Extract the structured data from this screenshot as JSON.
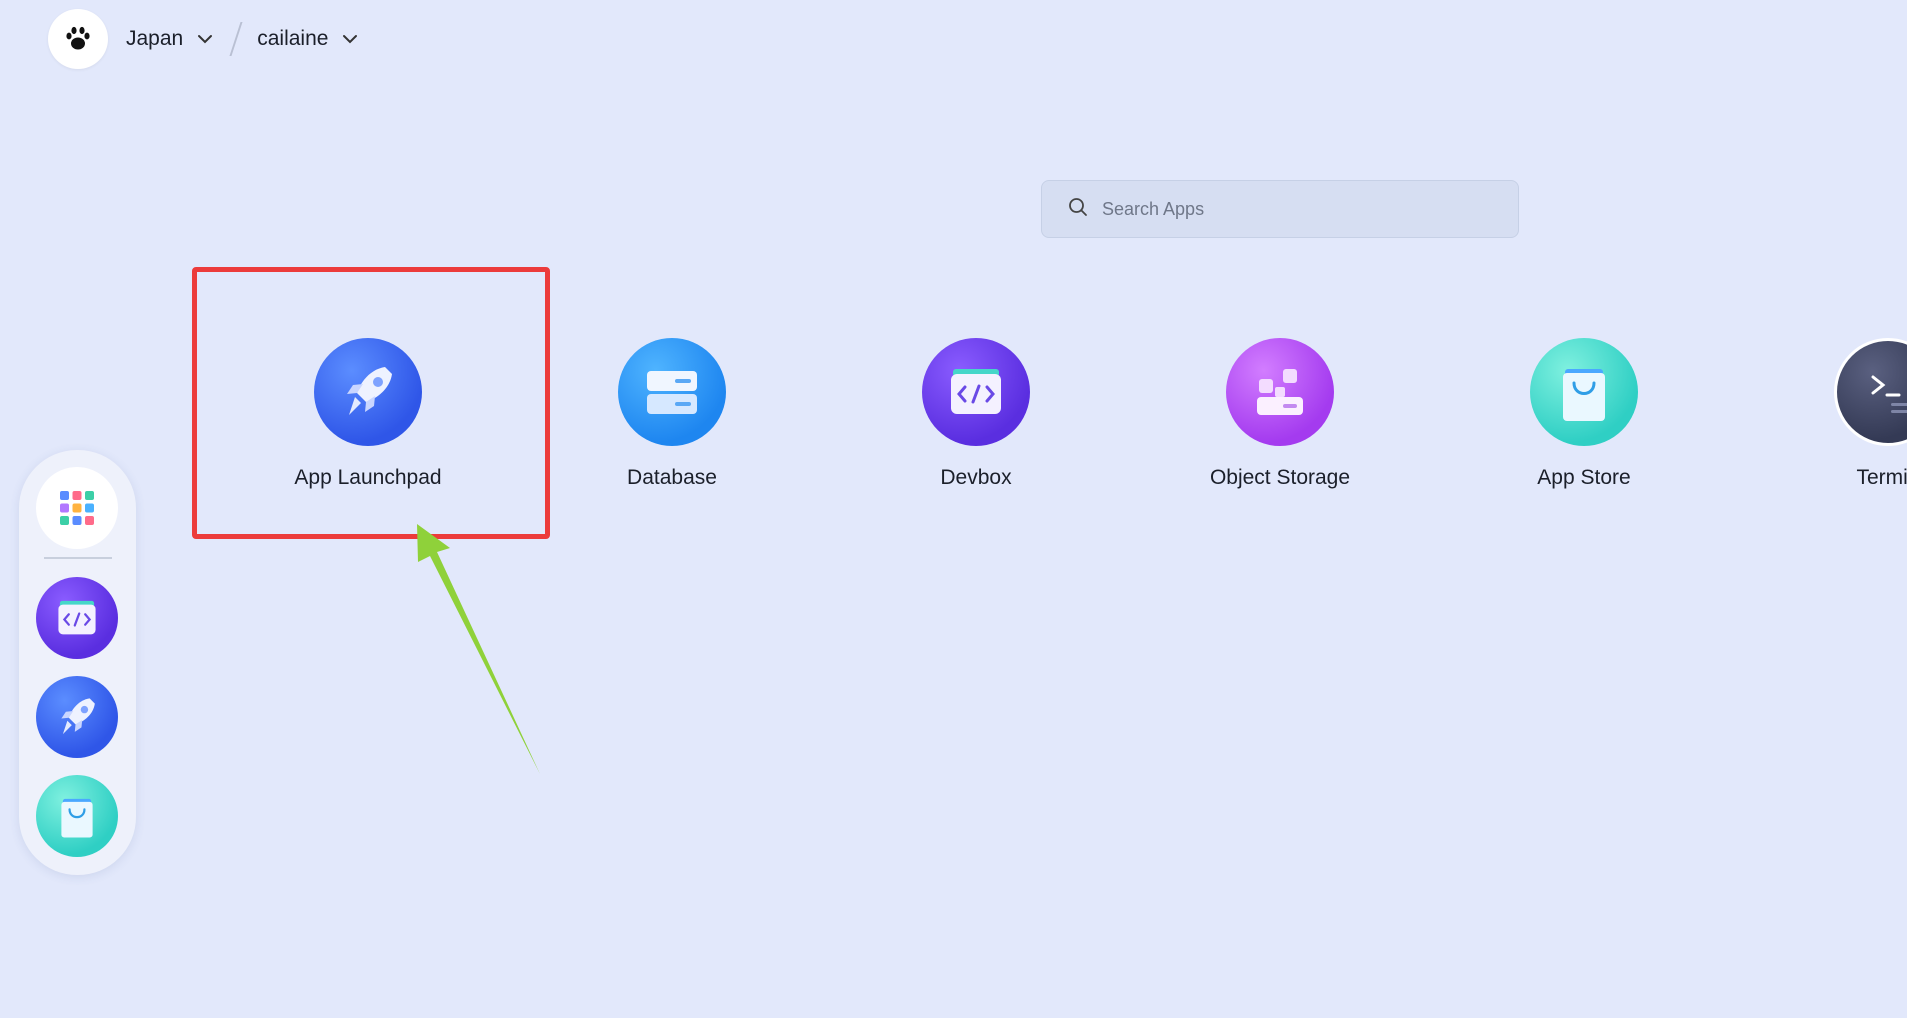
{
  "header": {
    "region": "Japan",
    "workspace": "cailaine"
  },
  "search": {
    "placeholder": "Search Apps"
  },
  "apps": [
    {
      "label": "App Launchpad",
      "icon": "rocket-icon"
    },
    {
      "label": "Database",
      "icon": "database-icon"
    },
    {
      "label": "Devbox",
      "icon": "devbox-icon"
    },
    {
      "label": "Object Storage",
      "icon": "object-storage-icon"
    },
    {
      "label": "App Store",
      "icon": "shopping-bag-icon"
    },
    {
      "label": "Termin",
      "icon": "terminal-icon"
    }
  ],
  "dock": {
    "items": [
      {
        "icon": "app-grid-icon"
      },
      {
        "icon": "devbox-icon"
      },
      {
        "icon": "rocket-icon"
      },
      {
        "icon": "shopping-bag-icon"
      }
    ]
  },
  "colors": {
    "background": "#e2e8fb",
    "highlight": "#ec3b3b",
    "arrow": "#8fd13a"
  }
}
